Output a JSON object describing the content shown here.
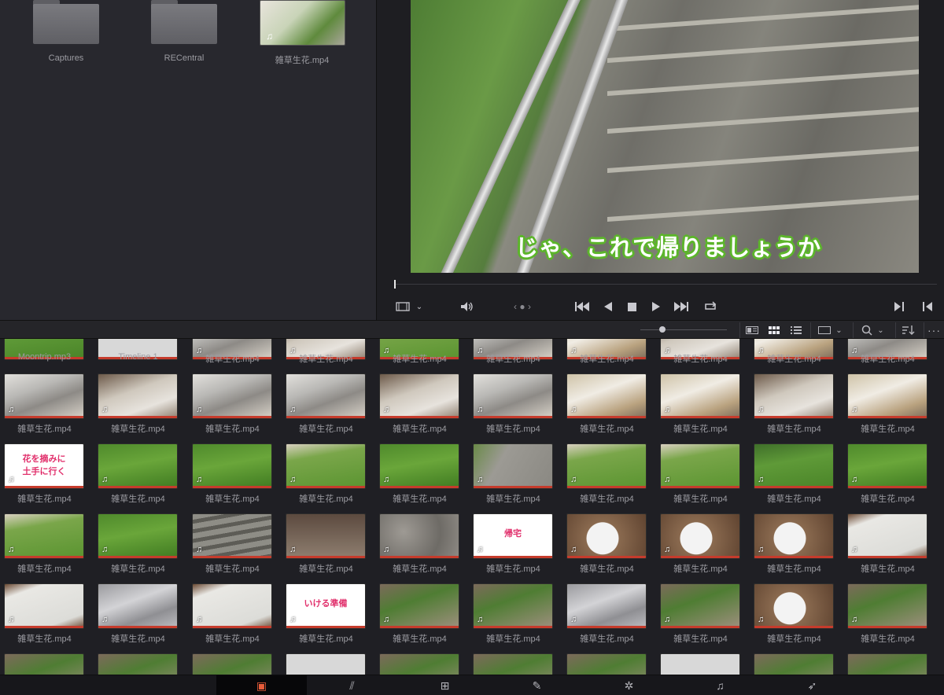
{
  "storage": {
    "folders": [
      {
        "label": "Captures"
      },
      {
        "label": "RECentral"
      }
    ],
    "file": {
      "label": "雑草生花.mp4"
    }
  },
  "viewer": {
    "subtitle": "じゃ、これで帰りましょうか",
    "controls": {
      "clip_menu_icon": "film-strip-icon",
      "volume_icon": "speaker-icon",
      "nav_dots": "‹ ● ›",
      "transport": [
        "skip-start",
        "step-back",
        "stop",
        "play",
        "skip-end",
        "loop"
      ],
      "mark_in": "▶|",
      "mark_out": "|◀"
    }
  },
  "toolbar": {
    "zoom_fraction": 0.25,
    "view_modes": [
      "metadata-view",
      "thumbnail-view",
      "list-view"
    ],
    "active_view": "thumbnail-view"
  },
  "pool": {
    "rows": [
      {
        "labels": [
          "Moontrip.mp3",
          "Timeline 1",
          "雑草生花.mp4",
          "雑草生花.mp4",
          "雑草生花.mp4",
          "雑草生花.mp4",
          "雑草生花.mp4",
          "雑草生花.mp4",
          "雑草生花.mp4",
          "雑草生花.mp4"
        ]
      },
      {
        "labels": [
          "雑草生花.mp4",
          "雑草生花.mp4",
          "雑草生花.mp4",
          "雑草生花.mp4",
          "雑草生花.mp4",
          "雑草生花.mp4",
          "雑草生花.mp4",
          "雑草生花.mp4",
          "雑草生花.mp4",
          "雑草生花.mp4"
        ]
      },
      {
        "labels": [
          "雑草生花.mp4",
          "雑草生花.mp4",
          "雑草生花.mp4",
          "雑草生花.mp4",
          "雑草生花.mp4",
          "雑草生花.mp4",
          "雑草生花.mp4",
          "雑草生花.mp4",
          "雑草生花.mp4",
          "雑草生花.mp4"
        ]
      },
      {
        "labels": [
          "雑草生花.mp4",
          "雑草生花.mp4",
          "雑草生花.mp4",
          "雑草生花.mp4",
          "雑草生花.mp4",
          "雑草生花.mp4",
          "雑草生花.mp4",
          "雑草生花.mp4",
          "雑草生花.mp4",
          "雑草生花.mp4"
        ]
      },
      {
        "labels": [
          "雑草生花.mp4",
          "雑草生花.mp4",
          "雑草生花.mp4",
          "雑草生花.mp4",
          "雑草生花.mp4",
          "雑草生花.mp4",
          "雑草生花.mp4",
          "雑草生花.mp4",
          "雑草生花.mp4",
          "雑草生花.mp4"
        ]
      }
    ],
    "title_cards": {
      "r2c1": "花を摘みに\n土手に行く",
      "r3c6": "帰宅",
      "r4c4": "いける準備"
    }
  },
  "pagenav": {
    "pages": [
      {
        "name": "media-page",
        "icon": "▣"
      },
      {
        "name": "cut-page",
        "icon": "⫽"
      },
      {
        "name": "edit-page",
        "icon": "⊞"
      },
      {
        "name": "fusion-page",
        "icon": "✎"
      },
      {
        "name": "color-page",
        "icon": "✲"
      },
      {
        "name": "fairlight-page",
        "icon": "♫"
      },
      {
        "name": "deliver-page",
        "icon": "➶"
      }
    ],
    "active": "media-page"
  }
}
